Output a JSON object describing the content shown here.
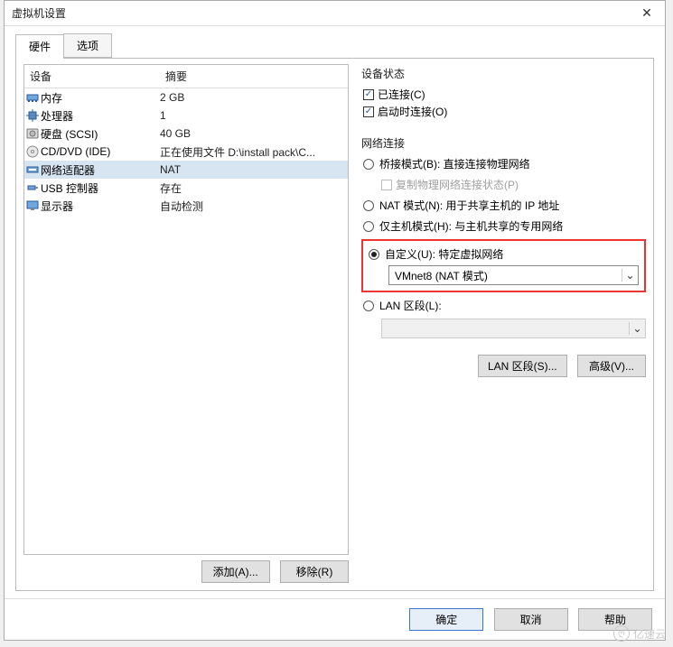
{
  "window": {
    "title": "虚拟机设置"
  },
  "tabs": {
    "hardware": "硬件",
    "options": "选项"
  },
  "table": {
    "col_device": "设备",
    "col_summary": "摘要",
    "rows": [
      {
        "icon": "memory",
        "device": "内存",
        "summary": "2 GB"
      },
      {
        "icon": "cpu",
        "device": "处理器",
        "summary": "1"
      },
      {
        "icon": "disk",
        "device": "硬盘 (SCSI)",
        "summary": "40 GB"
      },
      {
        "icon": "cd",
        "device": "CD/DVD (IDE)",
        "summary": "正在使用文件 D:\\install pack\\C..."
      },
      {
        "icon": "net",
        "device": "网络适配器",
        "summary": "NAT",
        "selected": true
      },
      {
        "icon": "usb",
        "device": "USB 控制器",
        "summary": "存在"
      },
      {
        "icon": "display",
        "device": "显示器",
        "summary": "自动检测"
      }
    ]
  },
  "left_buttons": {
    "add": "添加(A)...",
    "remove": "移除(R)"
  },
  "right": {
    "device_status_label": "设备状态",
    "connected": "已连接(C)",
    "connect_at_power": "启动时连接(O)",
    "network_label": "网络连接",
    "bridged": "桥接模式(B): 直接连接物理网络",
    "replicate": "复制物理网络连接状态(P)",
    "nat": "NAT 模式(N): 用于共享主机的 IP 地址",
    "hostonly": "仅主机模式(H): 与主机共享的专用网络",
    "custom": "自定义(U): 特定虚拟网络",
    "custom_value": "VMnet8 (NAT 模式)",
    "lan_segment": "LAN 区段(L):",
    "lan_segment_value": "",
    "lan_segments_btn": "LAN 区段(S)...",
    "advanced_btn": "高级(V)..."
  },
  "footer": {
    "ok": "确定",
    "cancel": "取消",
    "help": "帮助"
  },
  "watermark": "亿速云"
}
